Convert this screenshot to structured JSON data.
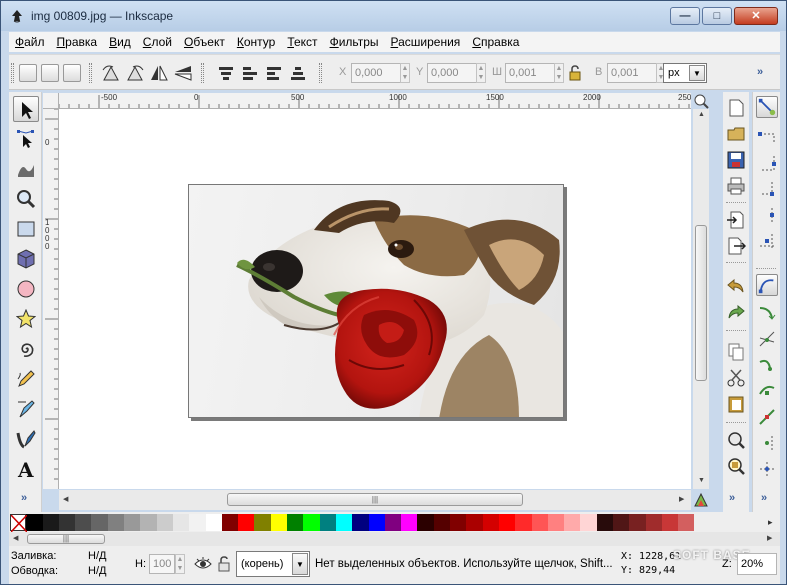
{
  "window": {
    "title": "img 00809.jpg — Inkscape"
  },
  "window_buttons": {
    "minimize": "—",
    "maximize": "□",
    "close": "✕"
  },
  "menu": [
    {
      "label": "Файл",
      "key": "Ф",
      "rest": "айл"
    },
    {
      "label": "Правка",
      "key": "П",
      "rest": "равка"
    },
    {
      "label": "Вид",
      "key": "В",
      "rest": "ид"
    },
    {
      "label": "Слой",
      "key": "С",
      "rest": "лой"
    },
    {
      "label": "Объект",
      "key": "О",
      "rest": "бъект"
    },
    {
      "label": "Контур",
      "key": "К",
      "rest": "онтур"
    },
    {
      "label": "Текст",
      "key": "Т",
      "rest": "екст"
    },
    {
      "label": "Фильтры",
      "key": "Ф",
      "rest": "ильтры"
    },
    {
      "label": "Расширения",
      "key": "Р",
      "rest": "асширения"
    },
    {
      "label": "Справка",
      "key": "С",
      "rest": "правка"
    }
  ],
  "toolbar": {
    "x_label": "X",
    "x_value": "0,000",
    "y_label": "Y",
    "y_value": "0,000",
    "w_label": "Ш",
    "w_value": "0,001",
    "h_label": "В",
    "h_value": "0,001",
    "unit": "px",
    "more": "»"
  },
  "ruler_top": [
    {
      "label": "-500"
    },
    {
      "label": "0"
    },
    {
      "label": "500"
    },
    {
      "label": "1000"
    },
    {
      "label": "1500"
    },
    {
      "label": "2000"
    },
    {
      "label": "250"
    }
  ],
  "ruler_left": [
    {
      "label": "0"
    },
    {
      "label": "1000"
    },
    {
      "label": "500"
    }
  ],
  "toolbox": {
    "more": "»"
  },
  "palette": {
    "more": "▸",
    "colors": [
      "#000000",
      "#1a1a1a",
      "#333333",
      "#4d4d4d",
      "#666666",
      "#808080",
      "#999999",
      "#b3b3b3",
      "#cccccc",
      "#e6e6e6",
      "#f2f2f2",
      "#ffffff",
      "#800000",
      "#ff0000",
      "#808000",
      "#ffff00",
      "#008000",
      "#00ff00",
      "#008080",
      "#00ffff",
      "#000080",
      "#0000ff",
      "#800080",
      "#ff00ff",
      "#2b0000",
      "#550000",
      "#800000",
      "#aa0000",
      "#d40000",
      "#ff0000",
      "#ff2a2a",
      "#ff5555",
      "#ff8080",
      "#ffaaaa",
      "#ffd5d5",
      "#280b0b",
      "#501616",
      "#782121",
      "#a02c2c",
      "#c83737",
      "#d35f5f"
    ]
  },
  "status": {
    "fill_label": "Заливка:",
    "fill_value": "Н/Д",
    "stroke_label": "Обводка:",
    "stroke_value": "Н/Д",
    "h_label": "Н:",
    "h_value": "100",
    "layer": "(корень)",
    "message": "Нет выделенных объектов. Используйте щелчок, Shift...",
    "x_coord": "X: 1228,61",
    "y_coord": "Y:  829,44",
    "zoom_label": "Z:",
    "zoom_value": "20%",
    "watermark": "SOFT BASE"
  }
}
